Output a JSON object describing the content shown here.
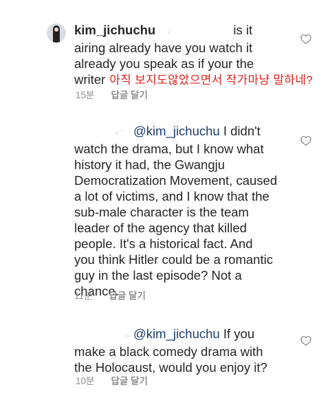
{
  "comments": [
    {
      "username": "kim_jichuchu",
      "username_dot": "·",
      "text_lines": [
        "is it",
        "airing already have you watch it",
        "already you speak as if your the",
        "writer"
      ],
      "annotation": "아직 보지도않았으면서 작가마냥 말하네?",
      "time": "15분",
      "reply_label": "답글 달기"
    },
    {
      "redacted_dots": "· ˙",
      "mention": "@kim_jichuchu",
      "text_lines": [
        "I didn't",
        "watch the drama, but I know what",
        "history it had, the Gwangju",
        "Democratization Movement, caused",
        "a lot of victims, and I know that the",
        "sub-male character is the team",
        "leader of the agency that killed",
        "people. It's a historical fact. And",
        "you think Hitler could be a romantic",
        "guy in the last episode? Not a",
        "chance."
      ],
      "time": "11분",
      "reply_label": "답글 달기"
    },
    {
      "redacted_dots": "·",
      "mention": "@kim_jichuchu",
      "text_lines": [
        "If you",
        "make a black comedy drama with",
        "the Holocaust, would you enjoy it?"
      ],
      "time": "10분",
      "reply_label": "답글 달기"
    }
  ],
  "colors": {
    "mention": "#1d3c6e",
    "annotation": "#e0201b",
    "meta": "#8e8e8e"
  },
  "icons": [
    "heart-icon",
    "avatar-image"
  ]
}
